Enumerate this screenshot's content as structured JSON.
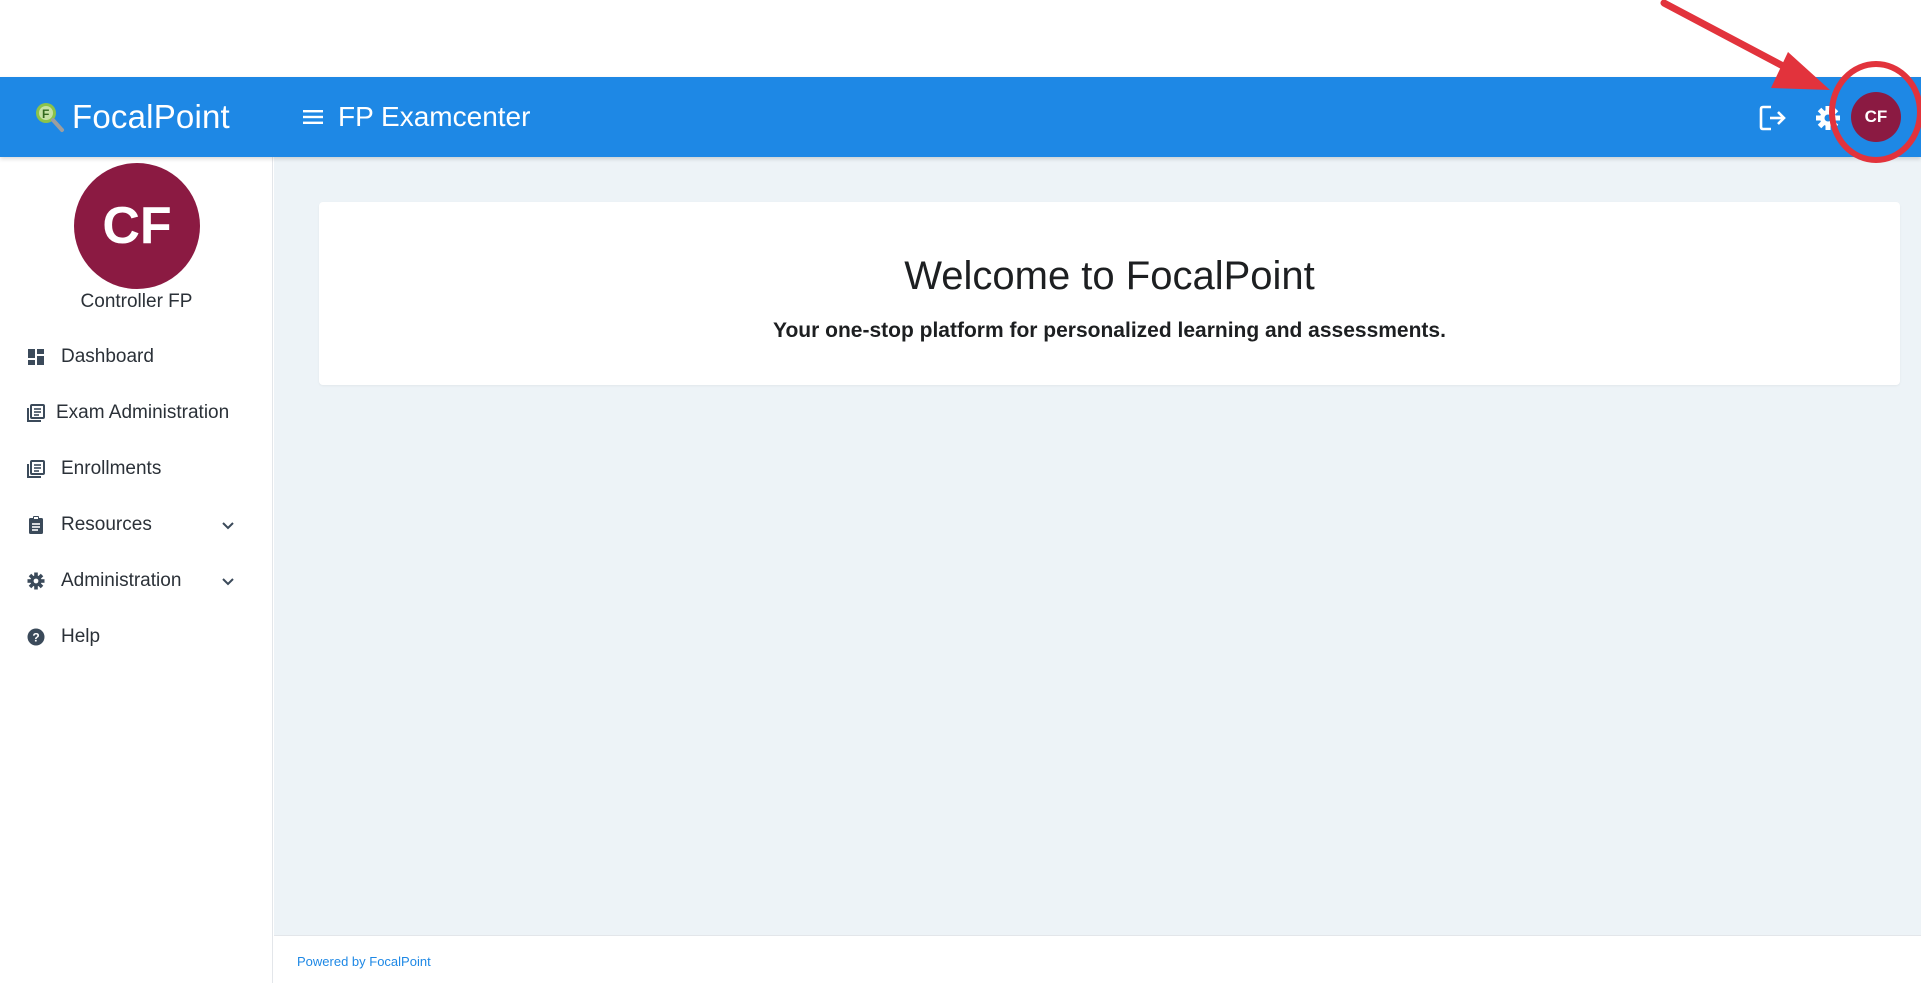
{
  "header": {
    "brand": "FocalPoint",
    "app_title": "FP Examcenter",
    "avatar_initials": "CF",
    "icons": [
      "menu-icon",
      "logout-icon",
      "gear-icon"
    ]
  },
  "sidebar": {
    "avatar_initials": "CF",
    "user_name": "Controller FP",
    "items": [
      {
        "label": "Dashboard",
        "icon": "dashboard-icon"
      },
      {
        "label": "Exam Administration",
        "icon": "book-icon"
      },
      {
        "label": "Enrollments",
        "icon": "book-icon"
      },
      {
        "label": "Resources",
        "icon": "clipboard-icon",
        "expandable": true
      },
      {
        "label": "Administration",
        "icon": "gear-icon",
        "expandable": true
      },
      {
        "label": "Help",
        "icon": "help-icon"
      }
    ]
  },
  "main": {
    "welcome_title": "Welcome to FocalPoint",
    "welcome_subtitle": "Your one-stop platform for personalized learning and assessments."
  },
  "footer": {
    "text": "Powered by FocalPoint"
  },
  "colors": {
    "appbar": "#1e88e5",
    "avatar": "#8b1a42",
    "content_bg": "#edf3f7",
    "annotation": "#e2333c"
  },
  "annotation": {
    "type": "red arrow and circle highlighting the user avatar"
  }
}
